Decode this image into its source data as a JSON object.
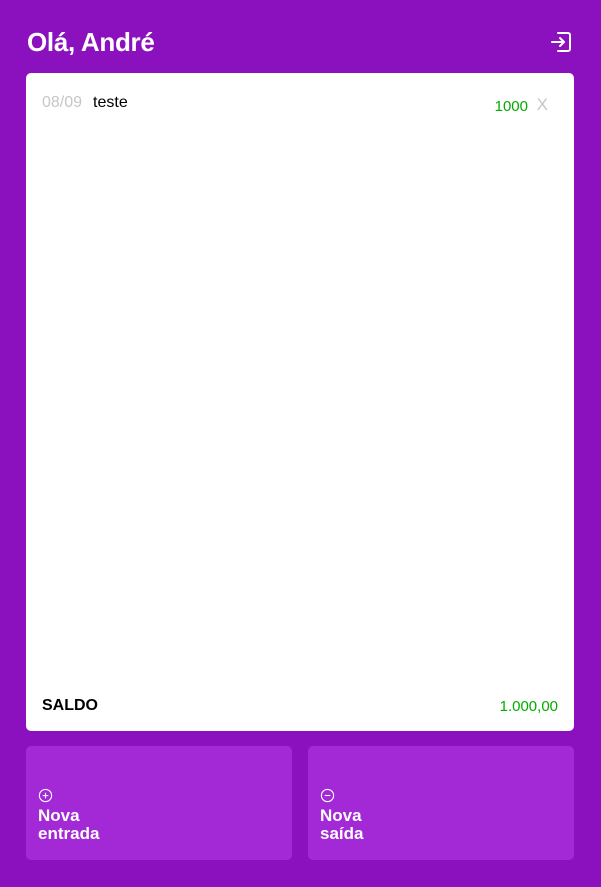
{
  "header": {
    "greeting": "Olá, André",
    "logout_icon": "logout-icon"
  },
  "records": [
    {
      "date": "08/09",
      "description": "teste",
      "value": "1000",
      "delete_label": "X",
      "type": "entrada"
    }
  ],
  "balance": {
    "label": "SALDO",
    "value": "1.000,00"
  },
  "actions": {
    "entrada": {
      "icon": "plus-circle-icon",
      "line1": "Nova",
      "line2": "entrada"
    },
    "saida": {
      "icon": "minus-circle-icon",
      "line1": "Nova",
      "line2": "saída"
    }
  },
  "colors": {
    "background": "#8c11be",
    "button": "#a328d6",
    "positive": "#03ac00",
    "muted": "#c6c6c6"
  }
}
